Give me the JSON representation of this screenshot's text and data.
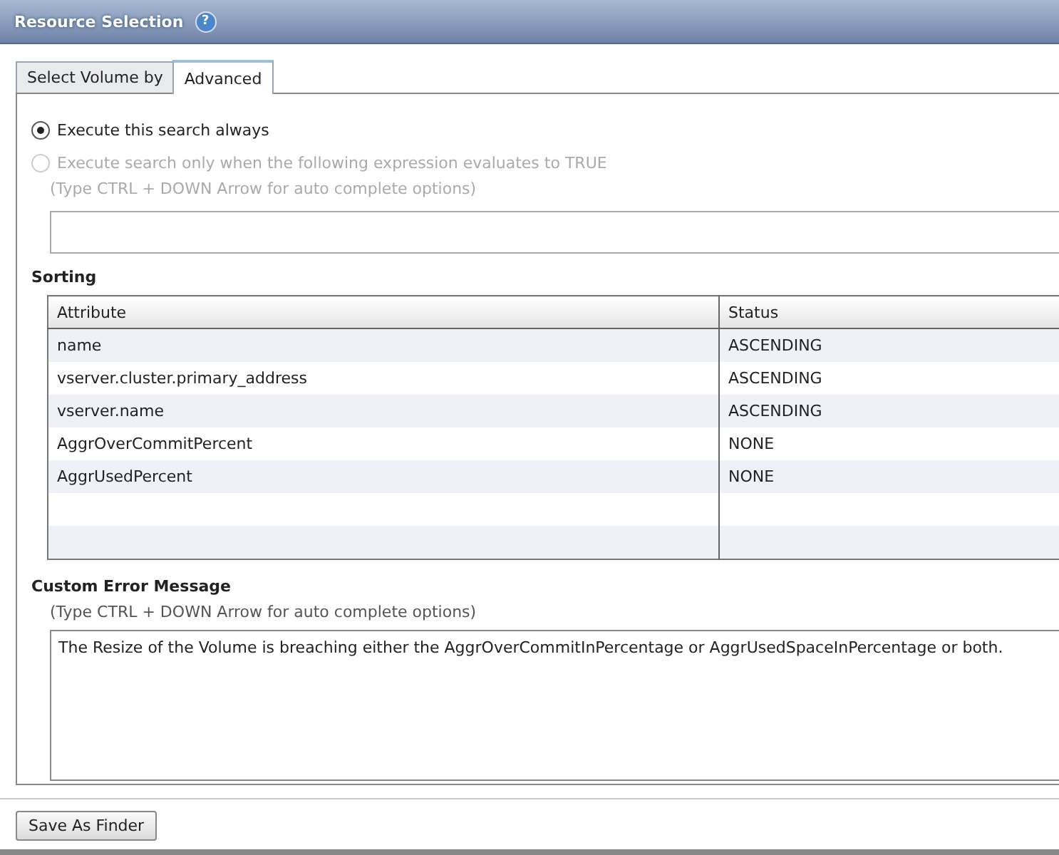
{
  "window": {
    "title": "Resource Selection",
    "help": "?"
  },
  "tabs": [
    {
      "label": "Select Volume by",
      "selected": false
    },
    {
      "label": "Advanced",
      "selected": true
    }
  ],
  "options": [
    {
      "label": "Execute this search always",
      "selected": true,
      "disabled": false
    },
    {
      "label": "Execute search only when the following expression evaluates to TRUE",
      "selected": false,
      "disabled": true
    }
  ],
  "expression": {
    "hint": "(Type CTRL + DOWN Arrow for auto complete options)",
    "disabled": true
  },
  "sorting": {
    "title": "Sorting",
    "columns": [
      "Attribute",
      "Status"
    ],
    "rows": [
      {
        "attribute": "name",
        "status": "ASCENDING"
      },
      {
        "attribute": "vserver.cluster.primary_address",
        "status": "ASCENDING"
      },
      {
        "attribute": "vserver.name",
        "status": "ASCENDING"
      },
      {
        "attribute": "AggrOverCommitPercent",
        "status": "NONE"
      },
      {
        "attribute": "AggrUsedPercent",
        "status": "NONE"
      }
    ]
  },
  "error_message": {
    "title": "Custom Error Message",
    "hint": "(Type CTRL + DOWN Arrow for auto complete options)",
    "value": "The Resize of the Volume is breaching either the AggrOverCommitInPercentage or AggrUsedSpaceInPercentage or both."
  },
  "buttons": [
    "Save As Finder"
  ]
}
